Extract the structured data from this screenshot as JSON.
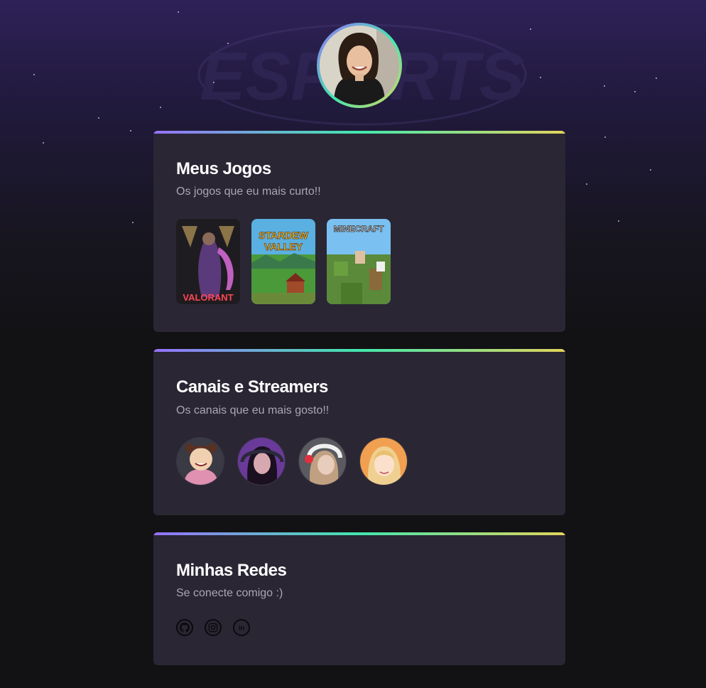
{
  "background": {
    "logo_text": "ESPORTS"
  },
  "profile": {
    "avatar": "profile-photo"
  },
  "sections": {
    "games": {
      "title": "Meus Jogos",
      "subtitle": "Os jogos que eu mais curto!!",
      "items": [
        {
          "name": "VALORANT",
          "icon": "valorant-cover"
        },
        {
          "name": "STARDEW VALLEY",
          "icon": "stardew-valley-cover"
        },
        {
          "name": "MINECRAFT",
          "icon": "minecraft-cover"
        }
      ]
    },
    "streamers": {
      "title": "Canais e Streamers",
      "subtitle": "Os canais que eu mais gosto!!",
      "items": [
        {
          "icon": "streamer-avatar"
        },
        {
          "icon": "streamer-avatar"
        },
        {
          "icon": "streamer-avatar"
        },
        {
          "icon": "streamer-avatar"
        }
      ]
    },
    "social": {
      "title": "Minhas Redes",
      "subtitle": "Se conecte comigo :)",
      "items": [
        {
          "icon": "github-icon"
        },
        {
          "icon": "instagram-icon"
        },
        {
          "icon": "linkedin-icon"
        }
      ]
    }
  },
  "colors": {
    "gradient_start": "#9572fc",
    "gradient_mid": "#43e7ad",
    "gradient_end": "#e2d45c",
    "card_bg": "#2a2634",
    "page_bg": "#121214"
  }
}
